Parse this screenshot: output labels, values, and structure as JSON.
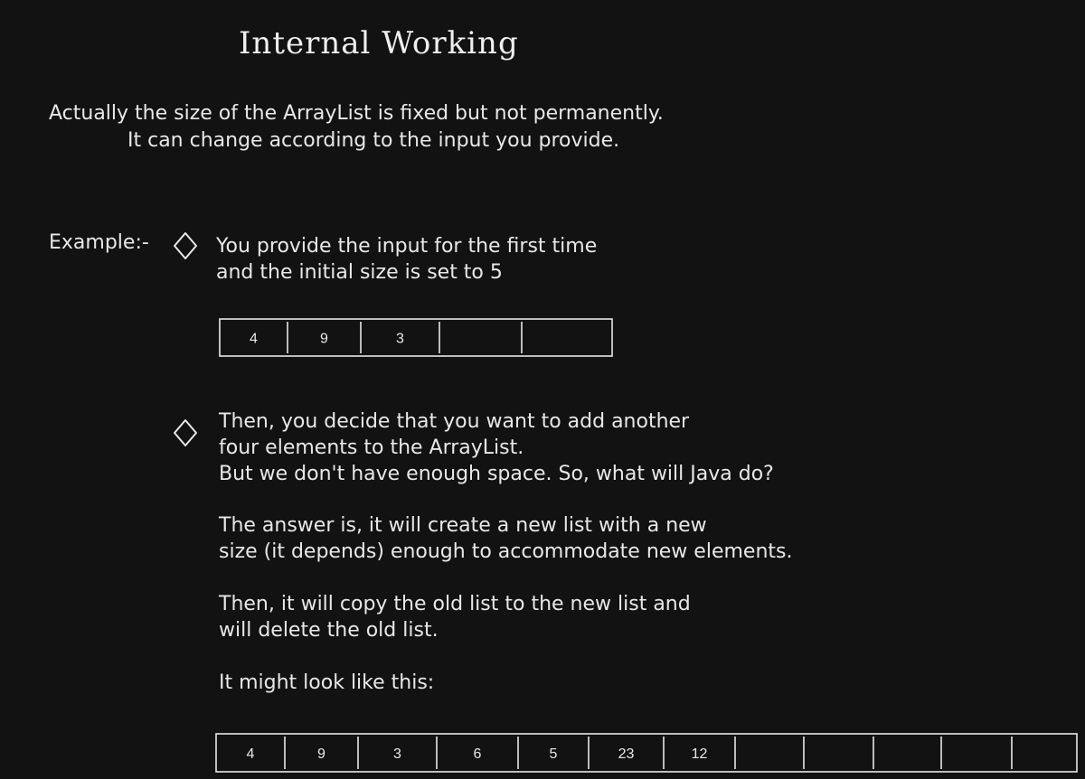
{
  "title": "Internal Working",
  "intro": {
    "line1": "Actually the size of the ArrayList is fixed but not permanently.",
    "line2": "It can change according to the input you provide."
  },
  "example_label": "Example:-",
  "step1": {
    "line1": "You provide the input for the first time",
    "line2": "and the initial size is set to 5"
  },
  "array1": {
    "values": [
      "4",
      "9",
      "3",
      "",
      ""
    ]
  },
  "step2": {
    "p1_line1": "Then, you decide that you want to add another",
    "p1_line2": "four elements to the ArrayList.",
    "p1_line3": "But we don't have enough space. So, what will Java do?",
    "p2_line1": "The answer is, it will create a new list with a new",
    "p2_line2": "size (it depends) enough to accommodate new elements.",
    "p3_line1": "Then, it will copy the old list to the new list and",
    "p3_line2": "will delete the old list.",
    "p4_line1": "It might look like this:"
  },
  "array2": {
    "values": [
      "4",
      "9",
      "3",
      "6",
      "5",
      "23",
      "12",
      "",
      "",
      "",
      "",
      ""
    ]
  },
  "colors": {
    "background": "#121212",
    "ink": "#e8e8e8"
  }
}
